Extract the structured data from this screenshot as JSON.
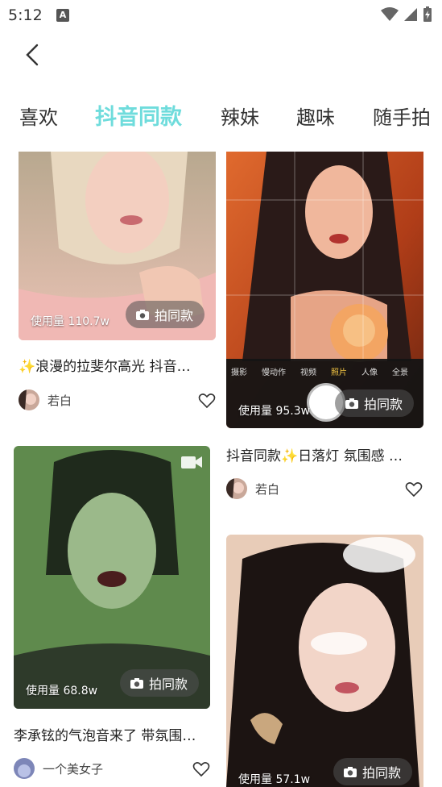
{
  "status": {
    "time": "5:12",
    "notif": "A"
  },
  "tabs": [
    {
      "label": "喜欢"
    },
    {
      "label": "抖音同款",
      "active": true
    },
    {
      "label": "辣妹"
    },
    {
      "label": "趣味"
    },
    {
      "label": "随手拍"
    }
  ],
  "colors": {
    "accent": "#6fdcdc"
  },
  "cards": [
    {
      "usage": "使用量 110.7w",
      "button": "拍同款",
      "title": "✨浪漫的拉斐尔高光 抖音…",
      "author": "若白"
    },
    {
      "usage": "使用量 95.3w",
      "button": "拍同款",
      "title": "抖音同款✨日落灯 氛围感 …",
      "author": "若白",
      "camera_modes": [
        "摄影",
        "慢动作",
        "视频",
        "照片",
        "人像",
        "全景"
      ],
      "camera_active": "照片"
    },
    {
      "usage": "使用量 68.8w",
      "button": "拍同款",
      "title": "李承铉的气泡音来了 带氛围…",
      "author": "一个美女子"
    },
    {
      "usage": "使用量 57.1w",
      "button": "拍同款"
    }
  ]
}
